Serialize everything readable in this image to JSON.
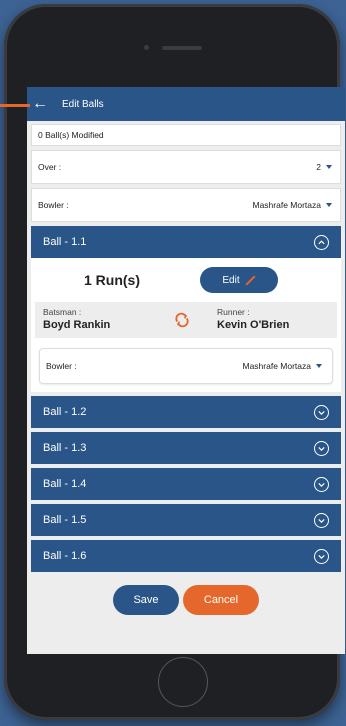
{
  "appbar": {
    "back_icon": "back-arrow-icon",
    "title": "Edit Balls"
  },
  "modified_text": "0 Ball(s) Modified",
  "over": {
    "label": "Over :",
    "value": "2"
  },
  "bowler": {
    "label": "Bowler :",
    "value": "Mashrafe Mortaza"
  },
  "balls": [
    {
      "title": "Ball - 1.1",
      "expanded": true,
      "runs": "1 Run(s)",
      "edit_label": "Edit",
      "batsman_label": "Batsman :",
      "batsman": "Boyd Rankin",
      "runner_label": "Runner :",
      "runner": "Kevin O'Brien",
      "bowler_label": "Bowler :",
      "bowler": "Mashrafe Mortaza"
    },
    {
      "title": "Ball - 1.2",
      "expanded": false
    },
    {
      "title": "Ball - 1.3",
      "expanded": false
    },
    {
      "title": "Ball - 1.4",
      "expanded": false
    },
    {
      "title": "Ball - 1.5",
      "expanded": false
    },
    {
      "title": "Ball - 1.6",
      "expanded": false
    }
  ],
  "actions": {
    "save_label": "Save",
    "cancel_label": "Cancel"
  },
  "colors": {
    "primary": "#2a5588",
    "accent": "#e5672b",
    "background": "#3d6394"
  }
}
